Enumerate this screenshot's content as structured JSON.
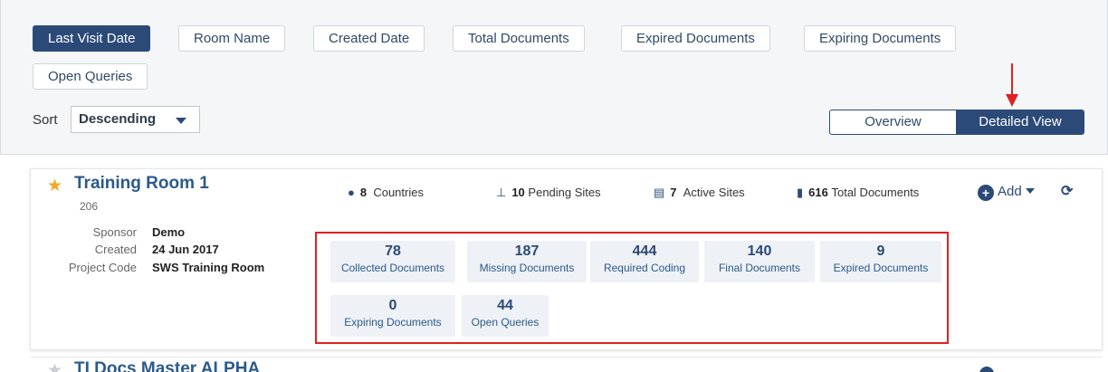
{
  "sort_buttons": [
    {
      "label": "Last Visit Date",
      "active": true
    },
    {
      "label": "Room Name",
      "active": false
    },
    {
      "label": "Created Date",
      "active": false
    },
    {
      "label": "Total Documents",
      "active": false
    },
    {
      "label": "Expired Documents",
      "active": false
    },
    {
      "label": "Expiring Documents",
      "active": false
    },
    {
      "label": "Open Queries",
      "active": false
    }
  ],
  "sort": {
    "label": "Sort",
    "value": "Descending"
  },
  "view_toggle": {
    "overview": "Overview",
    "detailed": "Detailed View",
    "selected": "Detailed View"
  },
  "room": {
    "title": "Training Room 1",
    "number": "206",
    "sponsor_label": "Sponsor",
    "sponsor": "Demo",
    "created_label": "Created",
    "created": "24 Jun 2017",
    "project_code_label": "Project Code",
    "project_code": "SWS Training Room",
    "stats": {
      "countries_count": "8",
      "countries_label": "Countries",
      "pending_count": "10",
      "pending_label": "Pending Sites",
      "active_count": "7",
      "active_label": "Active Sites",
      "total_count": "616",
      "total_label": "Total Documents"
    },
    "add_label": "Add",
    "tiles": [
      {
        "value": "78",
        "label": "Collected Documents"
      },
      {
        "value": "187",
        "label": "Missing Documents"
      },
      {
        "value": "444",
        "label": "Required Coding"
      },
      {
        "value": "140",
        "label": "Final Documents"
      },
      {
        "value": "9",
        "label": "Expired Documents"
      },
      {
        "value": "0",
        "label": "Expiring Documents"
      },
      {
        "value": "44",
        "label": "Open Queries"
      }
    ]
  },
  "next_room": {
    "title": "TI Docs Master ALPHA"
  },
  "colors": {
    "accent": "#2b4a78",
    "highlight": "#e02020",
    "star": "#f5a623"
  }
}
